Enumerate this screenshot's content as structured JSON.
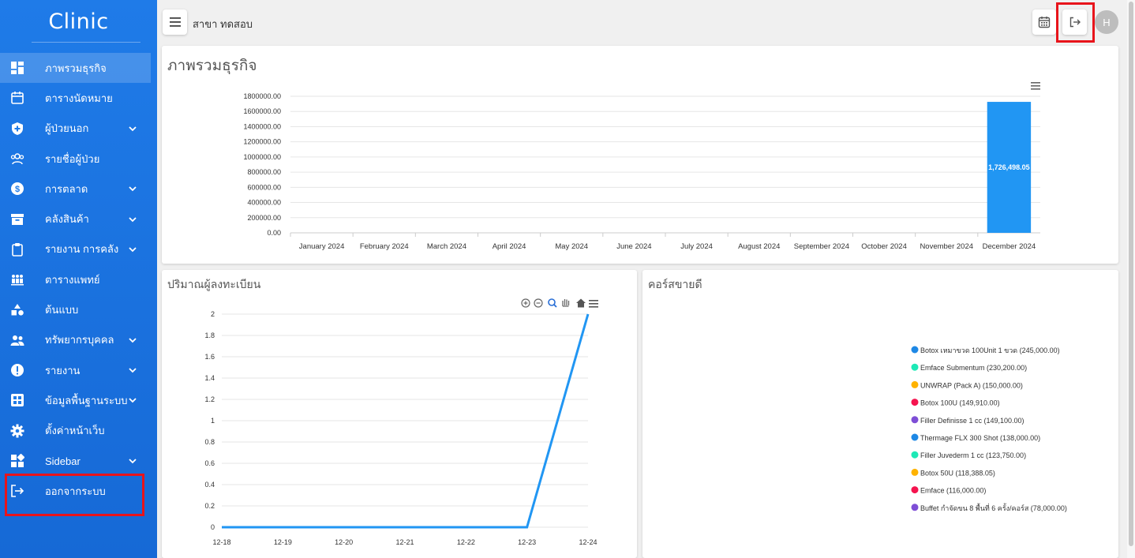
{
  "app": {
    "brand": "Clinic",
    "branch": "สาขา ทดสอบ",
    "avatar_initial": "H"
  },
  "sidebar": {
    "items": [
      {
        "label": "ภาพรวมธุรกิจ",
        "icon": "dashboard-icon",
        "chevron": false,
        "active": true
      },
      {
        "label": "ตารางนัดหมาย",
        "icon": "calendar-icon",
        "chevron": false
      },
      {
        "label": "ผู้ป่วยนอก",
        "icon": "shield-plus-icon",
        "chevron": true
      },
      {
        "label": "รายชื่อผู้ป่วย",
        "icon": "patients-icon",
        "chevron": false
      },
      {
        "label": "การตลาด",
        "icon": "dollar-icon",
        "chevron": true
      },
      {
        "label": "คลังสินค้า",
        "icon": "archive-icon",
        "chevron": true
      },
      {
        "label": "รายงาน การคลัง",
        "icon": "clipboard-icon",
        "chevron": true
      },
      {
        "label": "ตารางแพทย์",
        "icon": "doctors-icon",
        "chevron": false
      },
      {
        "label": "ต้นแบบ",
        "icon": "shapes-icon",
        "chevron": false
      },
      {
        "label": "ทรัพยากรบุคคล",
        "icon": "people-icon",
        "chevron": true
      },
      {
        "label": "รายงาน",
        "icon": "alert-icon",
        "chevron": true
      },
      {
        "label": "ข้อมูลพื้นฐานระบบ",
        "icon": "grid-icon",
        "chevron": true
      },
      {
        "label": "ตั้งค่าหน้าเว็บ",
        "icon": "gear-icon",
        "chevron": false
      },
      {
        "label": "Sidebar",
        "icon": "widgets-icon",
        "chevron": true
      },
      {
        "label": "ออกจากระบบ",
        "icon": "logout-icon",
        "chevron": false
      }
    ]
  },
  "colors": {
    "sidebar": "#1f7be8",
    "bar": "#2196f3",
    "line": "#2196f3",
    "highlight": "#e8141b"
  },
  "cards": {
    "overview_title": "ภาพรวมธุรกิจ",
    "registrations_title": "ปริมาณผู้ลงทะเบียน",
    "bestsellers_title": "คอร์สขายดี"
  },
  "chart_data": [
    {
      "type": "bar",
      "title": "",
      "categories": [
        "January 2024",
        "February 2024",
        "March 2024",
        "April 2024",
        "May 2024",
        "June 2024",
        "July 2024",
        "August 2024",
        "September 2024",
        "October 2024",
        "November 2024",
        "December 2024"
      ],
      "values": [
        0,
        0,
        0,
        0,
        0,
        0,
        0,
        0,
        0,
        0,
        0,
        1726498.05
      ],
      "data_labels": [
        "",
        "",
        "",
        "",
        "",
        "",
        "",
        "",
        "",
        "",
        "",
        "1,726,498.05"
      ],
      "ylim": [
        0,
        1800000
      ],
      "yticks": [
        "0.00",
        "200000.00",
        "400000.00",
        "600000.00",
        "800000.00",
        "1000000.00",
        "1200000.00",
        "1400000.00",
        "1600000.00",
        "1800000.00"
      ],
      "grid": true
    },
    {
      "type": "line",
      "title": "",
      "x": [
        "12-18",
        "12-19",
        "12-20",
        "12-21",
        "12-22",
        "12-23",
        "12-24"
      ],
      "values": [
        0,
        0,
        0,
        0,
        0,
        0,
        2
      ],
      "ylim": [
        0,
        2
      ],
      "yticks": [
        "0",
        "0.2",
        "0.4",
        "0.6",
        "0.8",
        "1",
        "1.2",
        "1.4",
        "1.6",
        "1.8",
        "2"
      ],
      "grid": true
    },
    {
      "type": "pie",
      "title": "",
      "legend_placement": "right",
      "series": [
        {
          "label": "Botox เหมาขวด 100Unit 1 ขวด (245,000.00)",
          "value": 245000,
          "color": "#1e88e5"
        },
        {
          "label": "Emface Submentum (230,200.00)",
          "value": 230200,
          "color": "#1de9b6"
        },
        {
          "label": "UNWRAP (Pack A) (150,000.00)",
          "value": 150000,
          "color": "#ffb300"
        },
        {
          "label": "Botox 100U (149,910.00)",
          "value": 149910,
          "color": "#f5144f"
        },
        {
          "label": "Filler Definisse 1 cc (149,100.00)",
          "value": 149100,
          "color": "#7e4ed6"
        },
        {
          "label": "Thermage FLX 300 Shot (138,000.00)",
          "value": 138000,
          "color": "#1e88e5"
        },
        {
          "label": "Filler Juvederm 1 cc (123,750.00)",
          "value": 123750,
          "color": "#1de9b6"
        },
        {
          "label": "Botox 50U (118,388.05)",
          "value": 118388.05,
          "color": "#ffb300"
        },
        {
          "label": "Emface (116,000.00)",
          "value": 116000,
          "color": "#f5144f"
        },
        {
          "label": "Buffet กำจัดขน 8 พื้นที่ 6 ครั้ง/คอร์ส (78,000.00)",
          "value": 78000,
          "color": "#7e4ed6"
        }
      ]
    }
  ]
}
